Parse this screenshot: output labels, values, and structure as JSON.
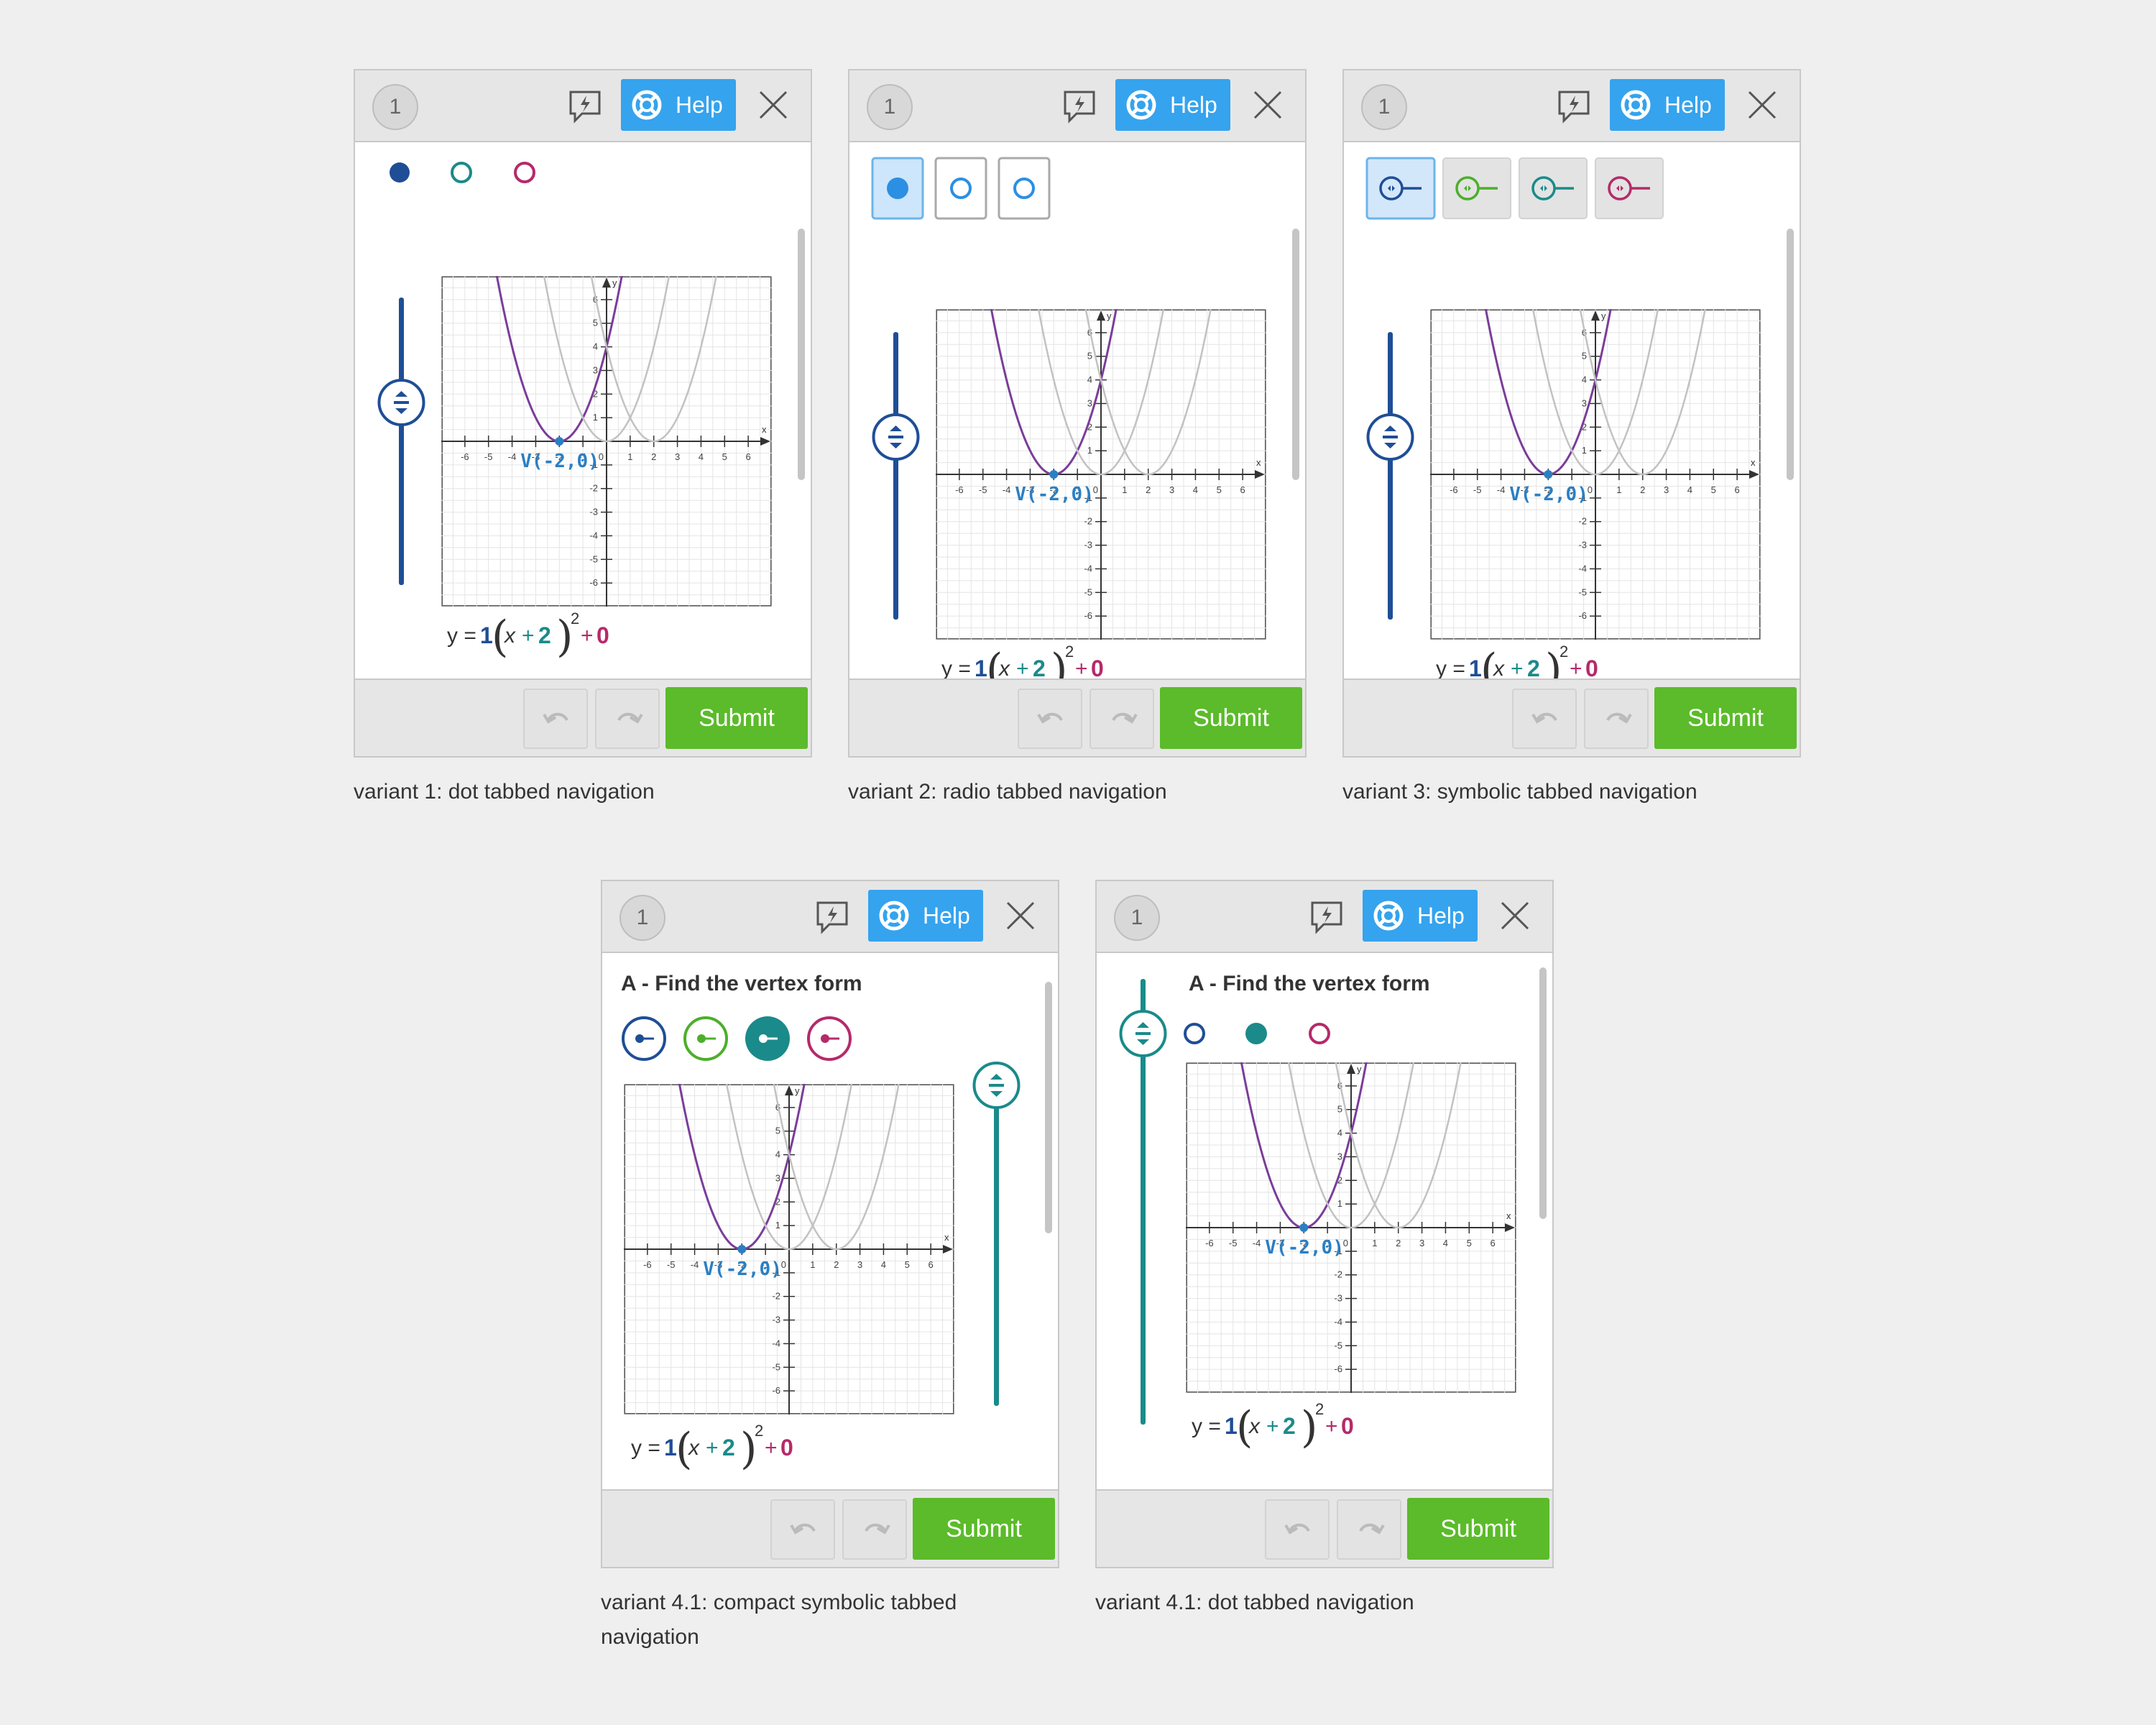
{
  "common": {
    "question_number": "1",
    "help_label": "Help",
    "submit_label": "Submit",
    "task_title": "A - Find the vertex form",
    "vertex_label": "V(-2,0)",
    "equation": {
      "y": "y =",
      "a": "1",
      "x": "x",
      "plus": "+",
      "h": "2",
      "exp": "2",
      "kplus": "+",
      "k": "0"
    },
    "axis_x_label": "x",
    "axis_y_label": "y",
    "x_ticks": [
      "-6",
      "-5",
      "-4",
      "-3",
      "-2",
      "-1",
      "0",
      "1",
      "2",
      "3",
      "4",
      "5",
      "6"
    ],
    "y_ticks": [
      "6",
      "5",
      "4",
      "3",
      "2",
      "1",
      "-1",
      "-2",
      "-3",
      "-4",
      "-5",
      "-6"
    ]
  },
  "captions": [
    "variant 1: dot tabbed navigation",
    "variant 2: radio tabbed navigation",
    "variant 3: symbolic tabbed navigation",
    "variant 4.1: compact symbolic tabbed navigation",
    "variant 4.1: dot tabbed navigation"
  ],
  "colors": {
    "navy": "#1f4e96",
    "teal": "#1b8a8a",
    "green": "#4caf2a",
    "magenta": "#b52a6a",
    "purple_curve": "#7a3d9a",
    "grey_curve": "#c2c2c2",
    "help_blue": "#35a3ee",
    "submit_green": "#5bbb2a"
  },
  "chart_data": {
    "type": "line",
    "xlim": [
      -7,
      7
    ],
    "ylim": [
      -7,
      7
    ],
    "grid": true,
    "series": [
      {
        "formula": "y = (x + 2)^2",
        "vertex": [
          -2,
          0
        ],
        "color": "#7a3d9a"
      },
      {
        "formula": "y = x^2",
        "vertex": [
          0,
          0
        ],
        "color": "#c2c2c2"
      },
      {
        "formula": "y = (x - 2)^2",
        "vertex": [
          2,
          0
        ],
        "color": "#c2c2c2"
      }
    ],
    "points": [
      {
        "x": -2,
        "y": 0,
        "label": "V(-2,0)"
      }
    ]
  }
}
